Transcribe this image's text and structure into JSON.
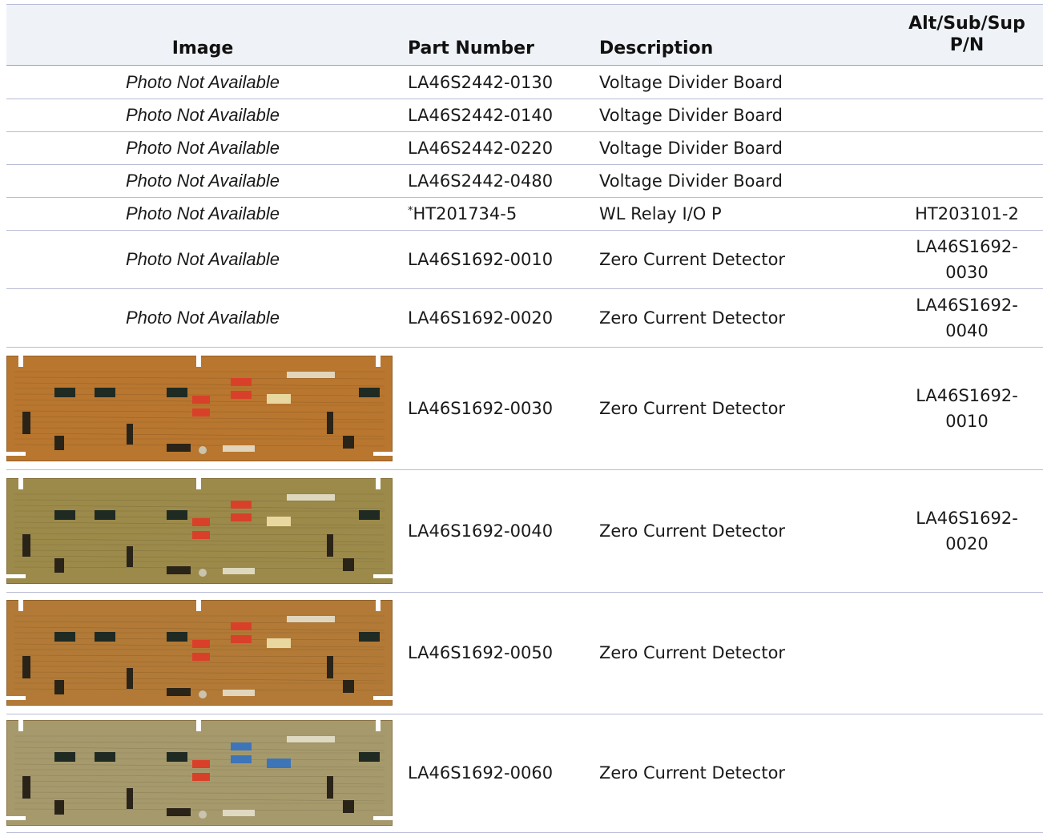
{
  "table": {
    "headers": {
      "image": "Image",
      "part_number": "Part Number",
      "description": "Description",
      "alt_line1": "Alt/Sub/Sup",
      "alt_line2": "P/N"
    },
    "rows": [
      {
        "image": "Photo Not Available",
        "part_prefix": "",
        "part": "LA46S2442-0130",
        "description": "Voltage Divider Board",
        "alt1": "",
        "alt2": ""
      },
      {
        "image": "Photo Not Available",
        "part_prefix": "",
        "part": "LA46S2442-0140",
        "description": "Voltage Divider Board",
        "alt1": "",
        "alt2": ""
      },
      {
        "image": "Photo Not Available",
        "part_prefix": "",
        "part": "LA46S2442-0220",
        "description": "Voltage Divider Board",
        "alt1": "",
        "alt2": ""
      },
      {
        "image": "Photo Not Available",
        "part_prefix": "",
        "part": "LA46S2442-0480",
        "description": "Voltage Divider Board",
        "alt1": "",
        "alt2": ""
      },
      {
        "image": "Photo Not Available",
        "part_prefix": "*",
        "part": "HT201734-5",
        "description": "WL Relay I/O P",
        "alt1": "HT203101-2",
        "alt2": ""
      },
      {
        "image": "Photo Not Available",
        "part_prefix": "",
        "part": "LA46S1692-0010",
        "description": "Zero Current Detector",
        "alt1": "LA46S1692-",
        "alt2": "0030"
      },
      {
        "image": "Photo Not Available",
        "part_prefix": "",
        "part": "LA46S1692-0020",
        "description": "Zero Current Detector",
        "alt1": "LA46S1692-",
        "alt2": "0040"
      },
      {
        "image": "circuit-board-photo",
        "part_prefix": "",
        "part": "LA46S1692-0030",
        "description": "Zero Current Detector",
        "alt1": "LA46S1692-",
        "alt2": "0010",
        "board_color": "#b8762f"
      },
      {
        "image": "circuit-board-photo",
        "part_prefix": "",
        "part": "LA46S1692-0040",
        "description": "Zero Current Detector",
        "alt1": "LA46S1692-",
        "alt2": "0020",
        "board_color": "#9c8a4a"
      },
      {
        "image": "circuit-board-photo",
        "part_prefix": "",
        "part": "LA46S1692-0050",
        "description": "Zero Current Detector",
        "alt1": "",
        "alt2": "",
        "board_color": "#b27a36"
      },
      {
        "image": "circuit-board-photo",
        "part_prefix": "",
        "part": "LA46S1692-0060",
        "description": "Zero Current Detector",
        "alt1": "",
        "alt2": "",
        "board_color": "#a69a6c"
      }
    ]
  }
}
